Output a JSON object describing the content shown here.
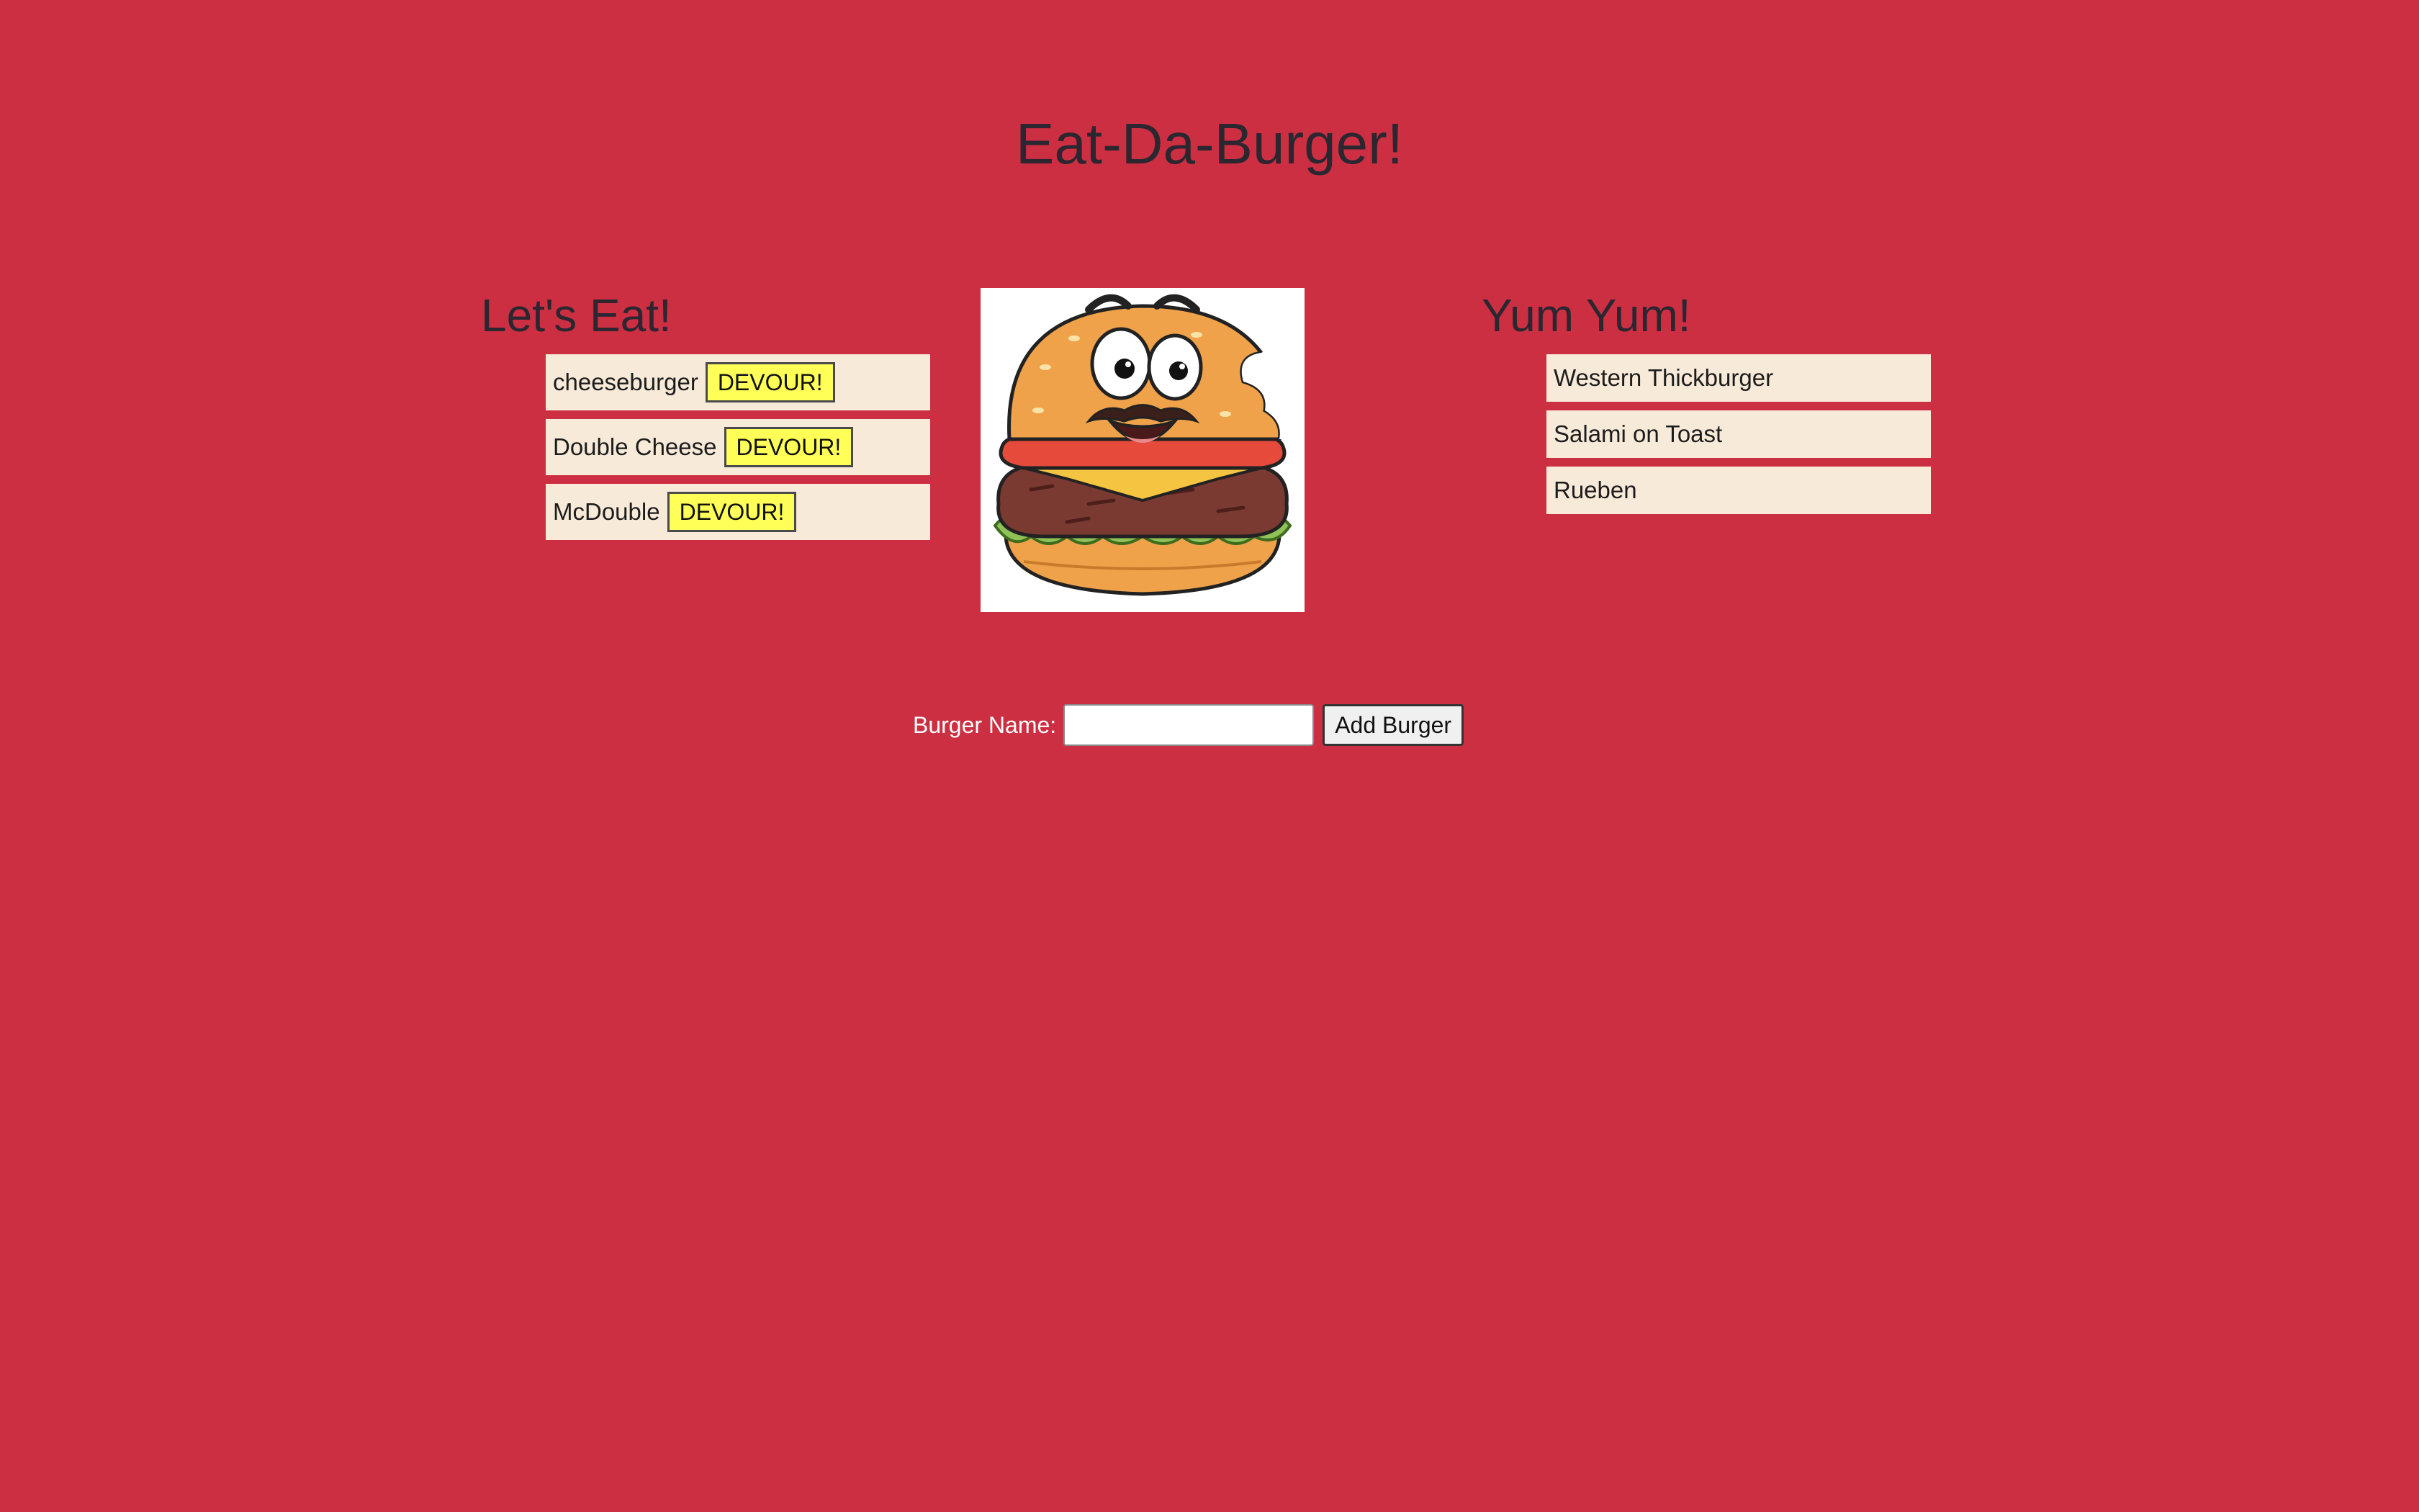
{
  "header": {
    "title": "Eat-Da-Burger!"
  },
  "uneaten": {
    "heading": "Let's Eat!",
    "button_label": "DEVOUR!",
    "items": [
      {
        "name": "cheeseburger"
      },
      {
        "name": "Double Cheese"
      },
      {
        "name": "McDouble"
      }
    ]
  },
  "devoured": {
    "heading": "Yum Yum!",
    "items": [
      {
        "name": "Western Thickburger"
      },
      {
        "name": "Salami on Toast"
      },
      {
        "name": "Rueben"
      }
    ]
  },
  "form": {
    "label": "Burger Name:",
    "input_value": "",
    "submit_label": "Add Burger"
  },
  "theme": {
    "background": "#cc2f42",
    "list_item_bg": "#f7ead8",
    "devour_button_bg": "#ffff57"
  },
  "icons": {
    "center_image": "cartoon-burger-illustration"
  }
}
